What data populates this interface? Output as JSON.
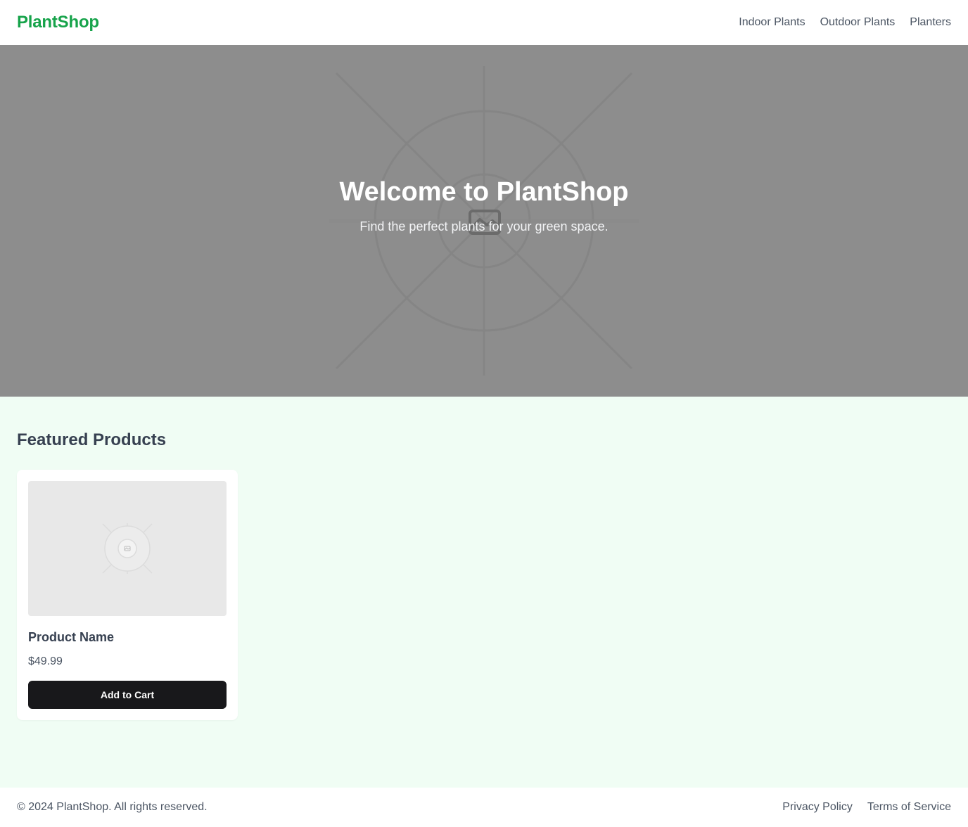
{
  "header": {
    "logo": "PlantShop",
    "nav": [
      {
        "label": "Indoor Plants"
      },
      {
        "label": "Outdoor Plants"
      },
      {
        "label": "Planters"
      }
    ]
  },
  "hero": {
    "title": "Welcome to PlantShop",
    "subtitle": "Find the perfect plants for your green space.",
    "background_color": "#8d8d8d",
    "image_icon": "image-placeholder-icon"
  },
  "featured": {
    "title": "Featured Products",
    "products": [
      {
        "name": "Product Name",
        "price": "$49.99",
        "button_label": "Add to Cart",
        "image_icon": "image-placeholder-icon"
      }
    ]
  },
  "footer": {
    "copyright": "© 2024 PlantShop. All rights reserved.",
    "links": [
      {
        "label": "Privacy Policy"
      },
      {
        "label": "Terms of Service"
      }
    ]
  },
  "colors": {
    "brand": "#16a34a",
    "main_background": "#f0fdf4",
    "button": "#18181b"
  }
}
